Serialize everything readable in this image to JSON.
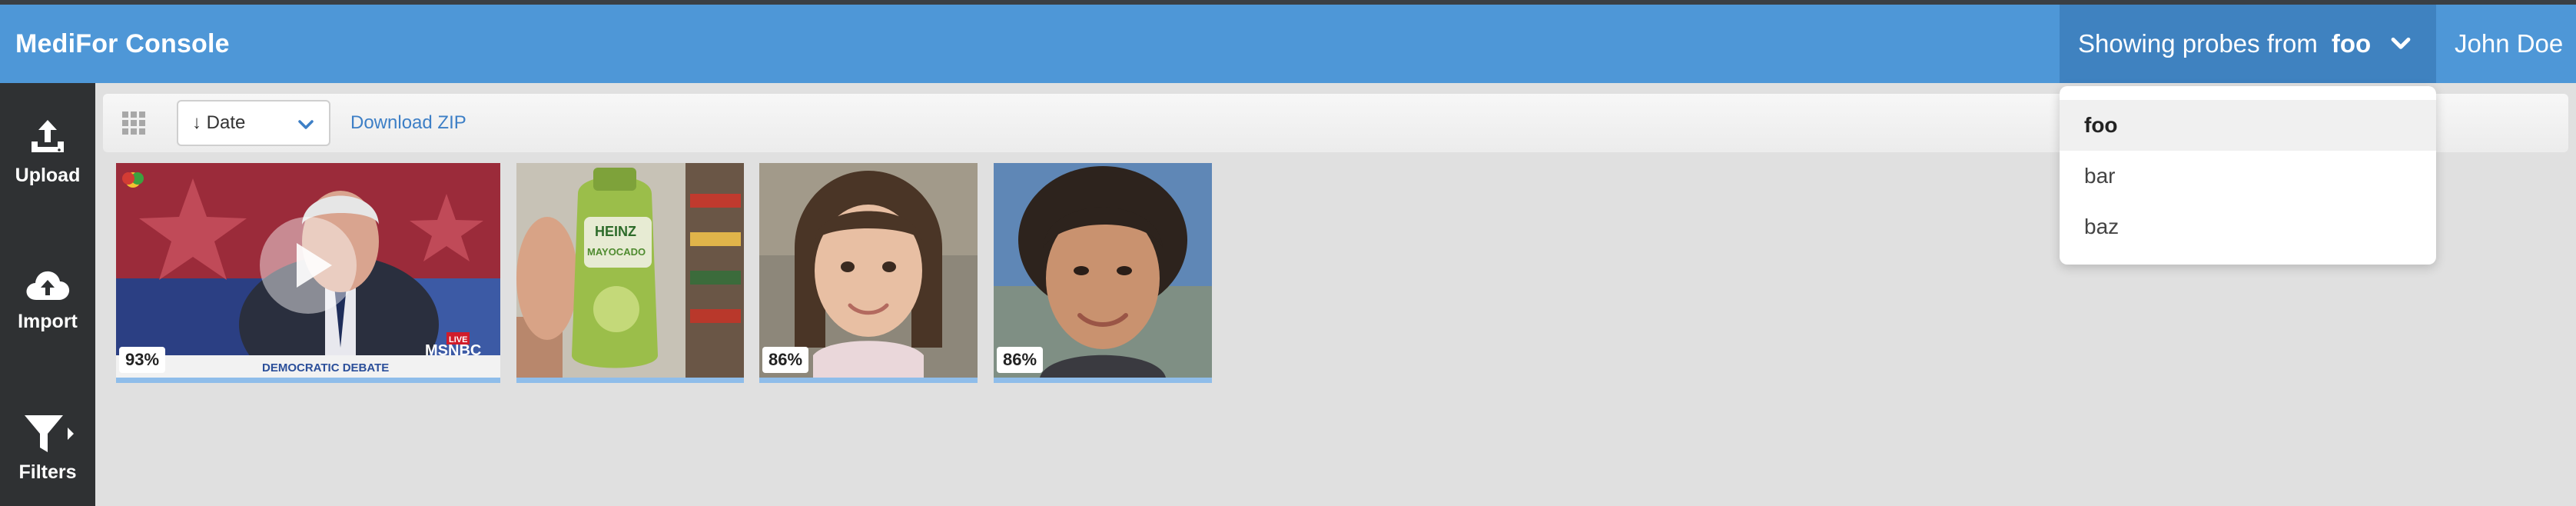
{
  "header": {
    "brand": "MediFor Console",
    "probe_prefix": "Showing probes from",
    "probe_source": "foo",
    "user_name": "John Doe",
    "accent": "#4e97d7"
  },
  "sidebar": {
    "items": [
      {
        "label": "Upload",
        "icon": "upload-icon"
      },
      {
        "label": "Import",
        "icon": "cloud-upload-icon"
      },
      {
        "label": "Filters",
        "icon": "filter-icon"
      }
    ]
  },
  "toolbar": {
    "sort_label": "↓ Date",
    "download_label": "Download ZIP"
  },
  "thumbnails": [
    {
      "kind": "video",
      "score": "93%",
      "overlay_text": "DEMOCRATIC DEBATE",
      "network": "MSNBC",
      "live": "LIVE"
    },
    {
      "kind": "image",
      "score": "",
      "product_text": "HEINZ",
      "product_sub": "MAYOCADO"
    },
    {
      "kind": "image",
      "score": "86%"
    },
    {
      "kind": "image",
      "score": "86%"
    }
  ],
  "dropdown": {
    "options": [
      "foo",
      "bar",
      "baz"
    ],
    "selected": "foo"
  }
}
